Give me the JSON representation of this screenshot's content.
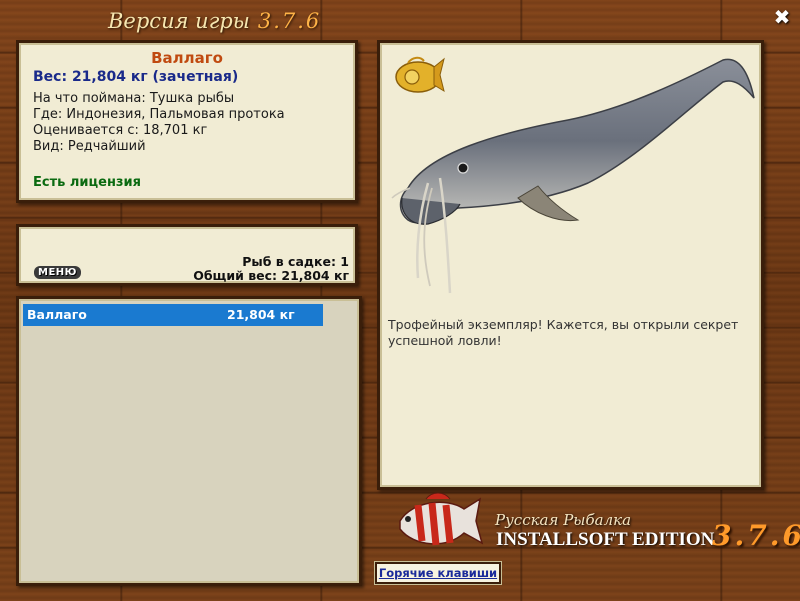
{
  "window": {
    "title": "Версия игры",
    "version": "3.7.6",
    "close_glyph": "✖"
  },
  "fish_info": {
    "name": "Валлаго",
    "weight": "Вес: 21,804 кг (зачетная)",
    "caught_on": "На что поймана: Тушка рыбы",
    "location": "Где: Индонезия, Пальмовая протока",
    "valued_from": "Оценивается с: 18,701 кг",
    "rarity": "Вид: Редчайший",
    "license": "Есть лицензия"
  },
  "cage": {
    "count": "Рыб в садке: 1",
    "total_weight": "Общий вес: 21,804 кг",
    "menu_label": "МЕНЮ"
  },
  "catch_list": [
    {
      "name": "Валлаго",
      "weight": "21,804 кг"
    }
  ],
  "trophy": {
    "description": "Трофейный экземпляр! Кажется, вы открыли секрет успешной ловли!",
    "fish_icon": "catfish-icon",
    "medal_icon": "golden-fish-medal-icon"
  },
  "branding": {
    "subtitle": "Русская Рыбалка",
    "edition": "INSTALLSOFT EDITION",
    "version": "3.7.6"
  },
  "hotkeys_label": "Горячие клавиши",
  "colors": {
    "fish_name": "#c04a10",
    "weight": "#1a2a8a",
    "license": "#0a6a10",
    "selection": "#1a7ad0",
    "version_accent": "#ff9a2a"
  }
}
